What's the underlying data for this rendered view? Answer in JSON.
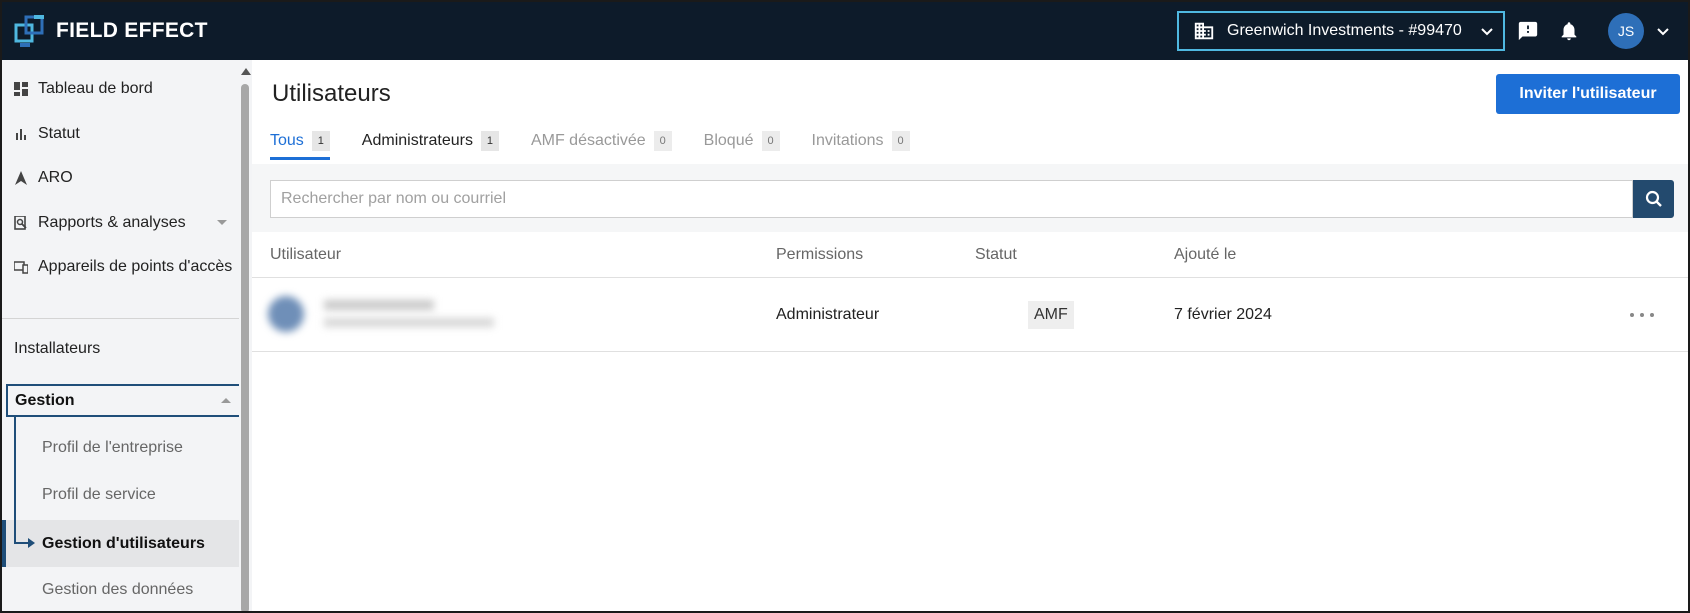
{
  "header": {
    "brand": "FIELD EFFECT",
    "organization": "Greenwich Investments - #99470",
    "user_initials": "JS"
  },
  "sidebar": {
    "items": [
      {
        "label": "Tableau de bord",
        "icon": "dashboard-icon"
      },
      {
        "label": "Statut",
        "icon": "bar-chart-icon"
      },
      {
        "label": "ARO",
        "icon": "navigation-arrow-icon"
      },
      {
        "label": "Rapports & analyses",
        "icon": "report-search-icon"
      },
      {
        "label": "Appareils de points d'accès",
        "icon": "devices-icon"
      }
    ],
    "installers": "Installateurs",
    "gestion": {
      "label": "Gestion",
      "children": [
        {
          "label": "Profil de l'entreprise"
        },
        {
          "label": "Profil de service"
        },
        {
          "label": "Gestion d'utilisateurs",
          "active": true
        },
        {
          "label": "Gestion des données"
        }
      ]
    }
  },
  "main": {
    "title": "Utilisateurs",
    "invite_label": "Inviter l'utilisateur",
    "tabs": [
      {
        "label": "Tous",
        "count": "1"
      },
      {
        "label": "Administrateurs",
        "count": "1"
      },
      {
        "label": "AMF désactivée",
        "count": "0"
      },
      {
        "label": "Bloqué",
        "count": "0"
      },
      {
        "label": "Invitations",
        "count": "0"
      }
    ],
    "search_placeholder": "Rechercher par nom ou courriel",
    "columns": {
      "user": "Utilisateur",
      "permissions": "Permissions",
      "status": "Statut",
      "added": "Ajouté le"
    },
    "rows": [
      {
        "permission": "Administrateur",
        "status": "AMF",
        "added": "7 février 2024"
      }
    ]
  },
  "colors": {
    "topbar": "#0d1b2a",
    "accent": "#1d6fd6",
    "highlight": "#4fb8e0",
    "nav_outline": "#1f4e79"
  }
}
